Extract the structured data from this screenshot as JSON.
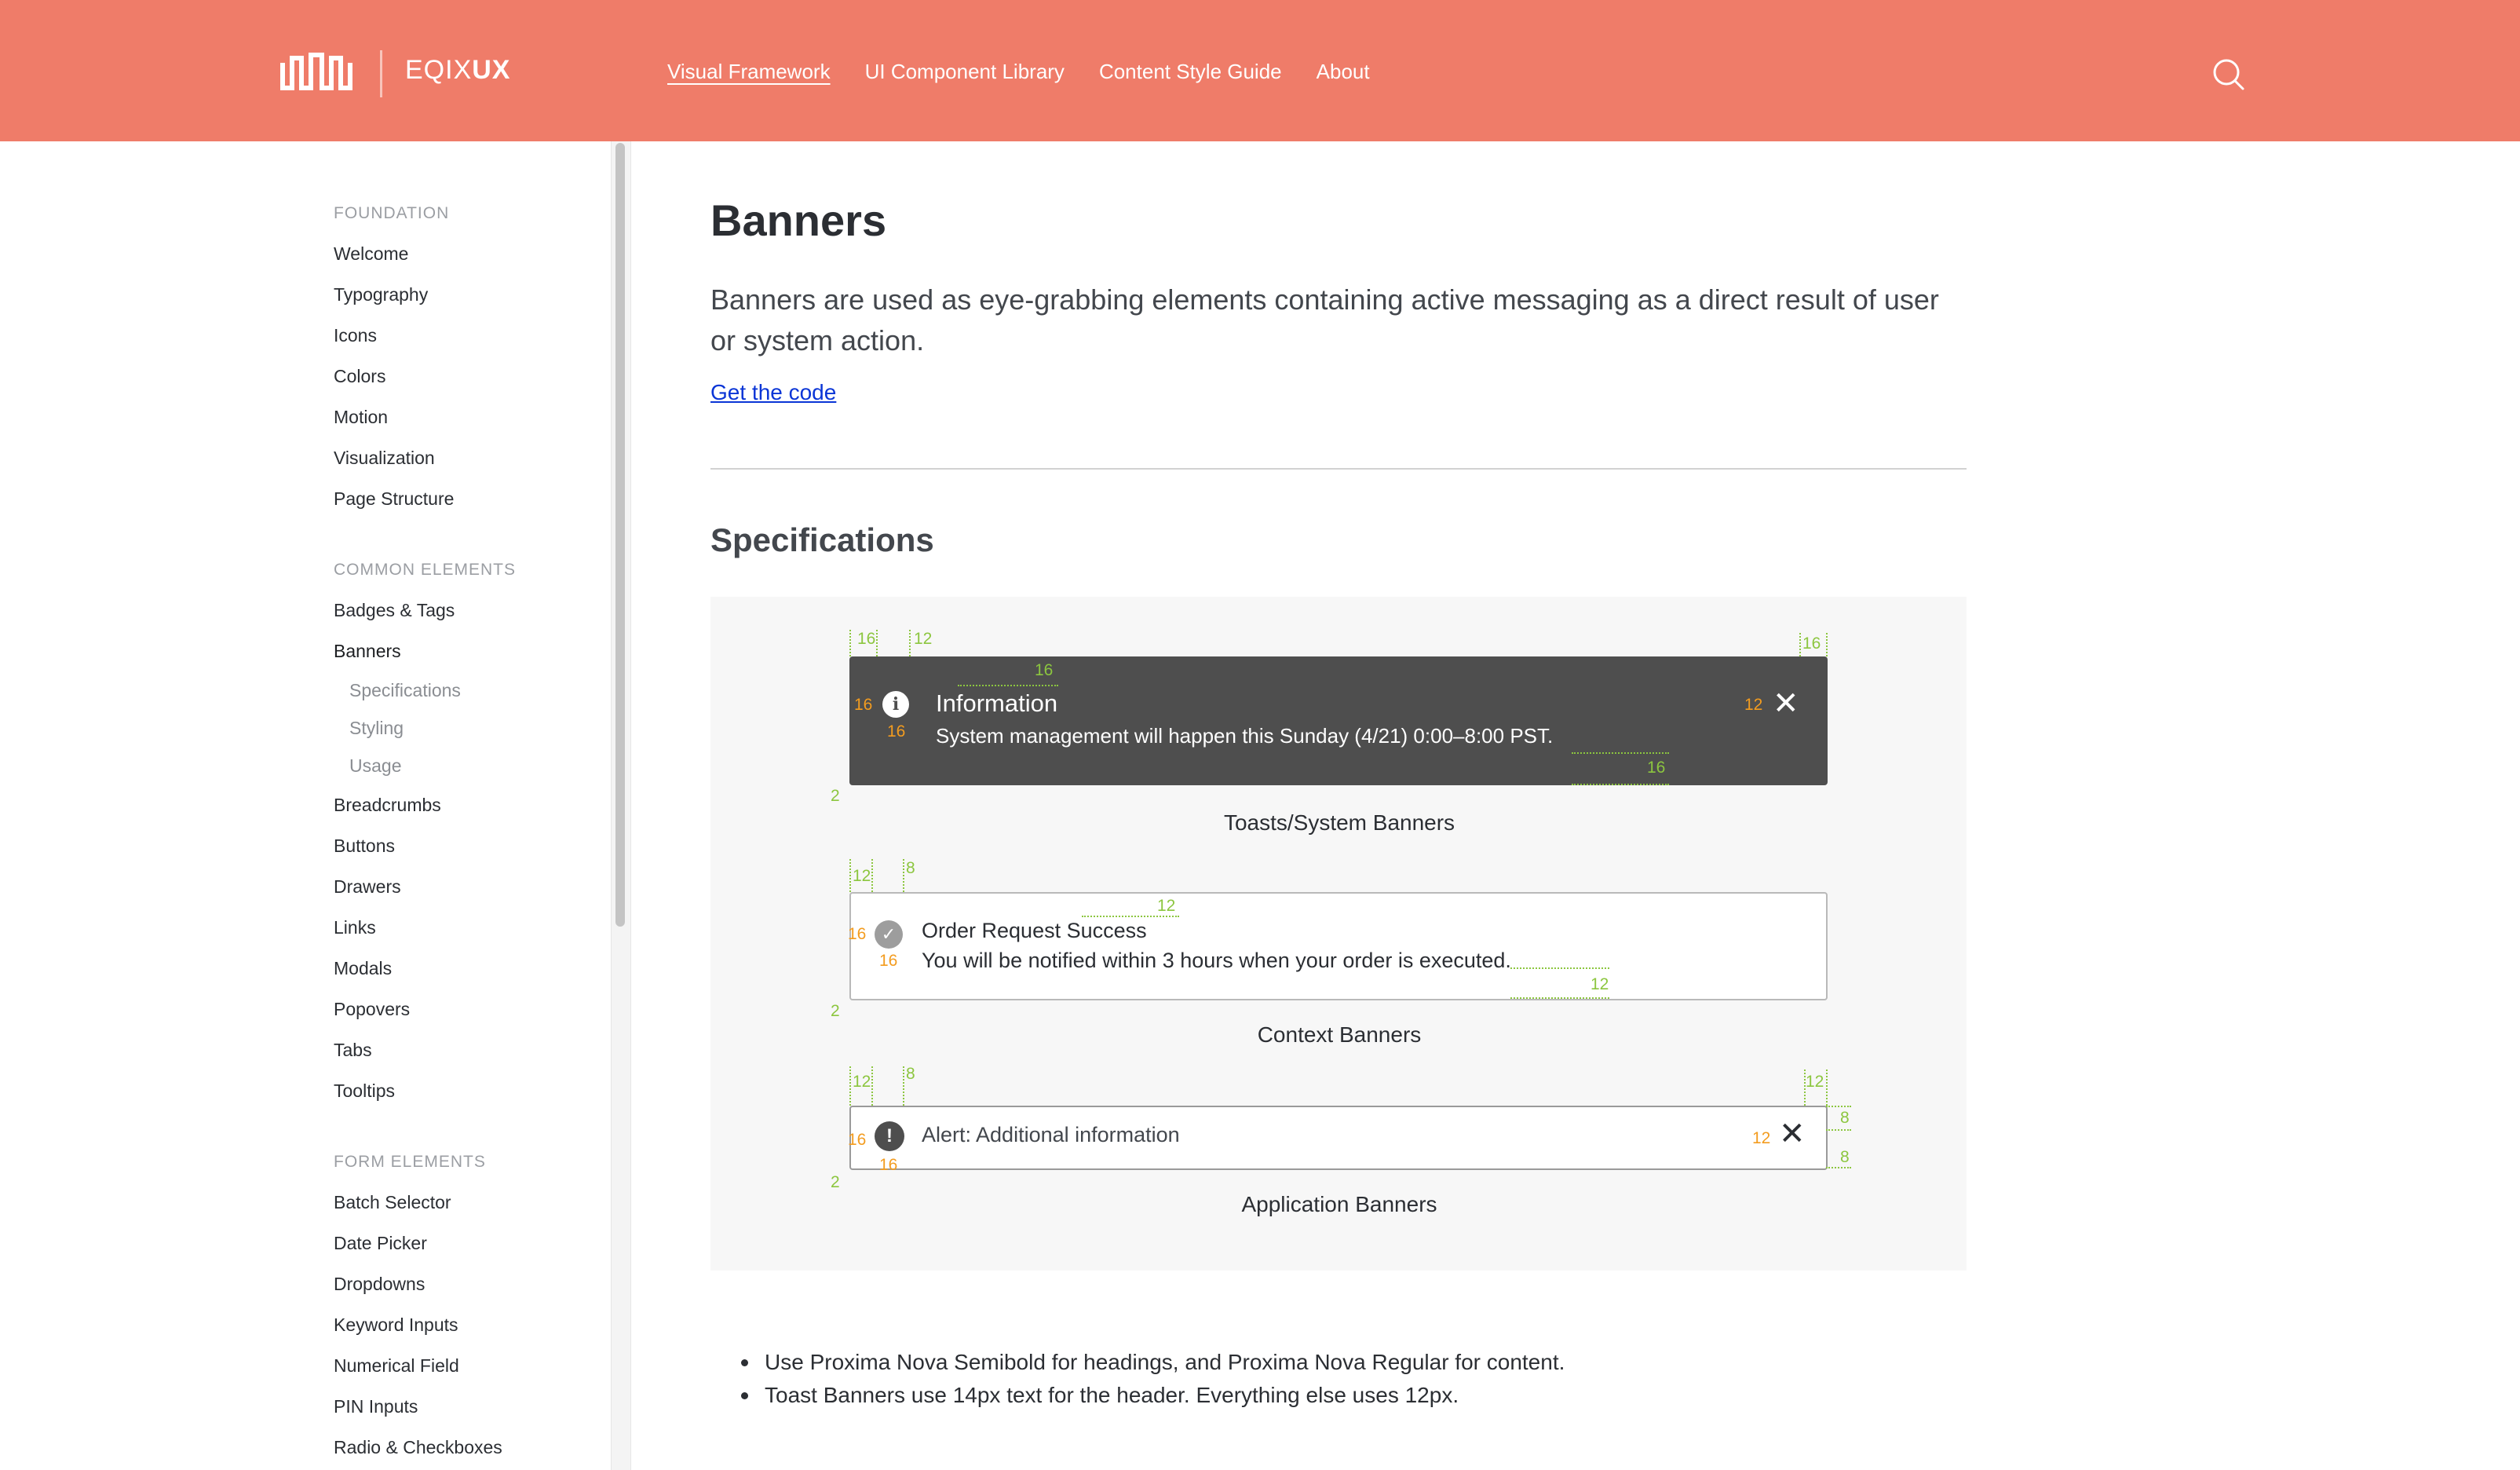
{
  "header": {
    "brand_light": "EQIX",
    "brand_bold": "UX",
    "nav": [
      {
        "label": "Visual Framework"
      },
      {
        "label": "UI Component Library"
      },
      {
        "label": "Content Style Guide"
      },
      {
        "label": "About"
      }
    ]
  },
  "sidebar": {
    "sections": [
      {
        "title": "FOUNDATION",
        "items": [
          "Welcome",
          "Typography",
          "Icons",
          "Colors",
          "Motion",
          "Visualization",
          "Page Structure"
        ]
      },
      {
        "title": "COMMON ELEMENTS",
        "items": [
          "Badges & Tags",
          "Banners",
          "Breadcrumbs",
          "Buttons",
          "Drawers",
          "Links",
          "Modals",
          "Popovers",
          "Tabs",
          "Tooltips"
        ]
      },
      {
        "title": "FORM ELEMENTS",
        "items": [
          "Batch Selector",
          "Date Picker",
          "Dropdowns",
          "Keyword Inputs",
          "Numerical Field",
          "PIN Inputs",
          "Radio & Checkboxes"
        ]
      }
    ],
    "banners_sub": [
      "Specifications",
      "Styling",
      "Usage"
    ]
  },
  "main": {
    "title": "Banners",
    "lead": "Banners are used as eye-grabbing elements containing active messaging as a direct result of user or system action.",
    "code_link": "Get the code",
    "spec_heading": "Specifications",
    "toast": {
      "title": "Information",
      "message": "System management will happen this Sunday (4/21) 0:00–8:00 PST.",
      "caption": "Toasts/System Banners"
    },
    "context": {
      "title": "Order Request Success",
      "message": "You will be notified within 3 hours when your order is executed.",
      "caption": "Context Banners"
    },
    "application": {
      "label": "Alert:  Additional information",
      "caption": "Application Banners"
    },
    "bullets": [
      "Use Proxima Nova Semibold for headings, and Proxima Nova Regular for content.",
      "Toast Banners use 14px text for the header. Everything else uses 12px."
    ],
    "spec_marks": {
      "m16": "16",
      "m12": "12",
      "m8": "8",
      "m2": "2"
    }
  }
}
